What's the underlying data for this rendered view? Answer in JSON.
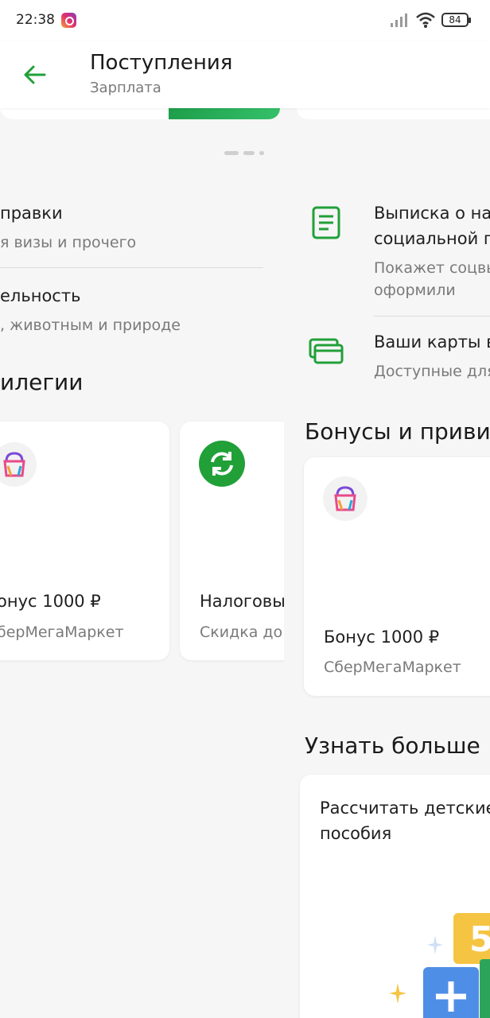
{
  "status_bar": {
    "time": "22:38",
    "battery": "84"
  },
  "header": {
    "title": "Поступления",
    "subtitle": "Зарплата"
  },
  "left_panel": {
    "rows": [
      {
        "title": "правки",
        "subtitle": "я визы и прочего"
      },
      {
        "title": "ельность",
        "subtitle": ", животным и природе"
      }
    ],
    "section_title": "илегии",
    "cards": [
      {
        "title": "онус 1000 ₽",
        "subtitle": "берМегаМаркет"
      },
      {
        "title": "Налоговы",
        "subtitle": "Скидка до"
      }
    ]
  },
  "right_panel": {
    "rows": [
      {
        "title_line1": "Выписка о на",
        "title_line2": "социальной п",
        "subtitle_line1": "Покажет соцвы",
        "subtitle_line2": "оформили",
        "icon": "document-icon"
      },
      {
        "title_line1": "Ваши карты в",
        "subtitle_line1": "Доступные для",
        "icon": "cards-icon"
      }
    ],
    "bonus_section_title": "Бонусы и приви",
    "bonus_card": {
      "title": "Бонус 1000 ₽",
      "subtitle": "СберМегаМаркет"
    },
    "learn_section_title": "Узнать больше",
    "learn_card": {
      "line1": "Рассчитать детские",
      "line2": "пособия",
      "tile_number": "5"
    }
  },
  "colors": {
    "accent": "#21a038",
    "text": "#1f1f1f",
    "secondary": "#7a7a7a",
    "background": "#f6f6f6"
  }
}
